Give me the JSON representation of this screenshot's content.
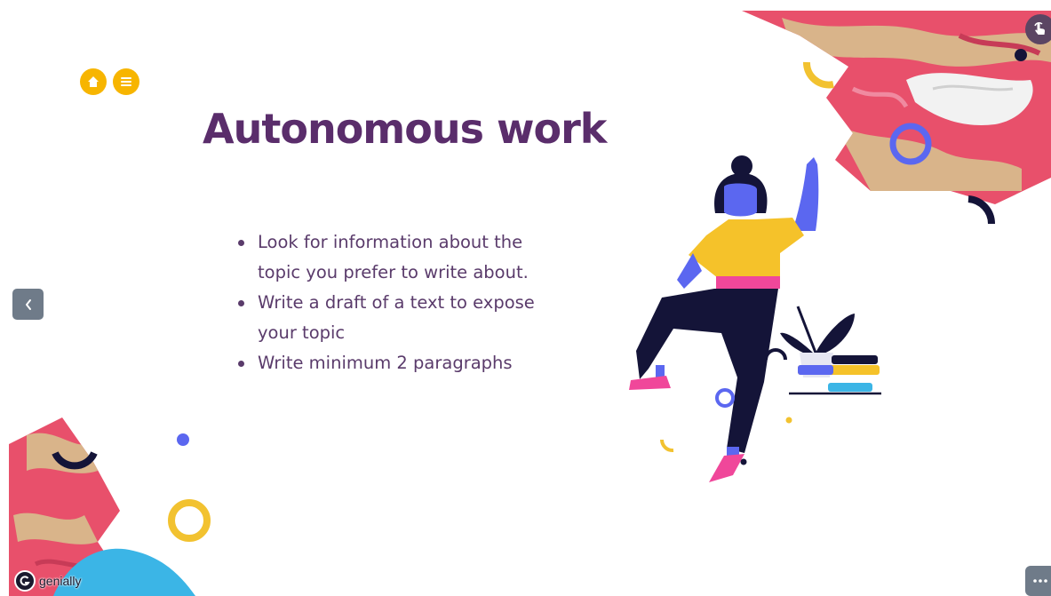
{
  "slide": {
    "title": "Autonomous work",
    "bullets": [
      "Look for information about the topic you prefer to write about.",
      "Write a draft of a text to expose your topic",
      "Write minimum 2 paragraphs"
    ]
  },
  "nav": {
    "home_icon": "home-icon",
    "menu_icon": "menu-icon",
    "prev_icon": "chevron-left-icon",
    "interact_icon": "hand-pointer-icon",
    "more_icon": "more-dots-icon"
  },
  "brand": {
    "label": "genially"
  },
  "colors": {
    "title": "#5a2d6b",
    "text": "#5a3b6b",
    "accent_yellow": "#f7b500",
    "marble_pink": "#e8506b",
    "periwinkle": "#5b67f0",
    "navy": "#141438",
    "sky": "#3bb5e6",
    "nav_gray": "#6f7b89"
  }
}
